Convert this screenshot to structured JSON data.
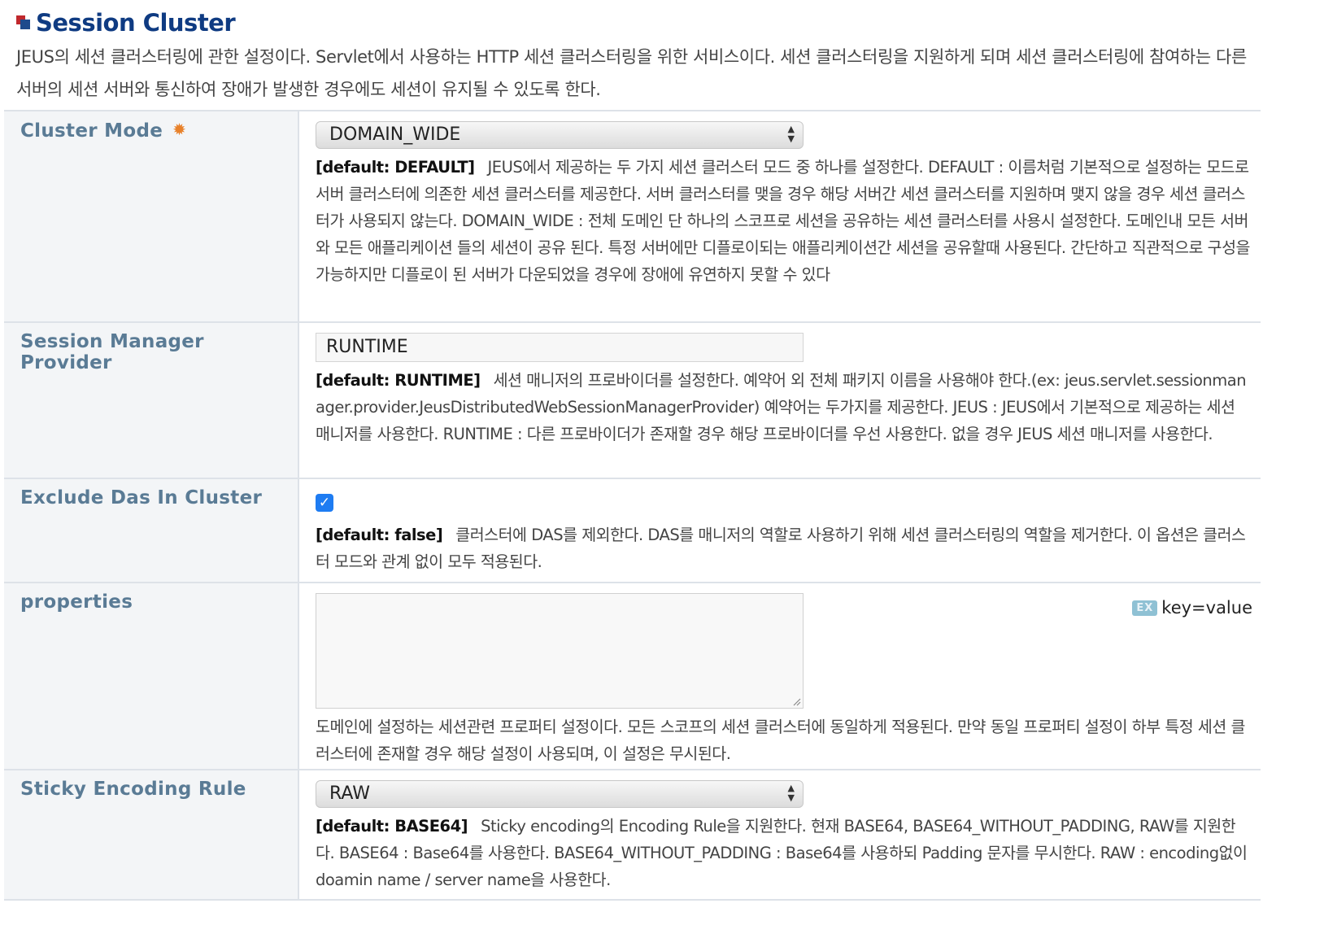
{
  "header": {
    "title": "Session Cluster",
    "description": "JEUS의 세션 클러스터링에 관한 설정이다. Servlet에서 사용하는 HTTP 세션 클러스터링을 위한 서비스이다. 세션 클러스터링을 지원하게 되며 세션 클러스터링에 참여하는 다른 서버의 세션 서버와 통신하여 장애가 발생한 경우에도 세션이 유지될 수 있도록 한다."
  },
  "fields": {
    "cluster_mode": {
      "label": "Cluster Mode",
      "required_icon": "gear-icon",
      "value": "DOMAIN_WIDE",
      "default": "[default: DEFAULT]",
      "description": "JEUS에서 제공하는 두 가지 세션 클러스터 모드 중 하나를 설정한다. DEFAULT : 이름처럼 기본적으로 설정하는 모드로 서버 클러스터에 의존한 세션 클러스터를 제공한다. 서버 클러스터를 맺을 경우 해당 서버간 세션 클러스터를 지원하며 맺지 않을 경우 세션 클러스터가 사용되지 않는다. DOMAIN_WIDE : 전체 도메인 단 하나의 스코프로 세션을 공유하는 세션 클러스터를 사용시 설정한다. 도메인내 모든 서버와 모든 애플리케이션 들의 세션이 공유 된다. 특정 서버에만 디플로이되는 애플리케이션간 세션을 공유할때 사용된다. 간단하고 직관적으로 구성을 가능하지만 디플로이 된 서버가 다운되었을 경우에 장애에 유연하지 못할 수 있다"
    },
    "session_manager_provider": {
      "label": "Session Manager Provider",
      "value": "RUNTIME",
      "default": "[default: RUNTIME]",
      "description": "세션 매니저의 프로바이더를 설정한다. 예약어 외 전체 패키지 이름을 사용해야 한다.(ex: jeus.servlet.sessionmanager.provider.JeusDistributedWebSessionManagerProvider) 예약어는 두가지를 제공한다. JEUS : JEUS에서 기본적으로 제공하는 세션 매니저를 사용한다. RUNTIME : 다른 프로바이더가 존재할 경우 해당 프로바이더를 우선 사용한다. 없을 경우 JEUS 세션 매니저를 사용한다."
    },
    "exclude_das": {
      "label": "Exclude Das In Cluster",
      "checked": true,
      "check_glyph": "✓",
      "default": "[default: false]",
      "description": "클러스터에 DAS를 제외한다. DAS를 매니저의 역할로 사용하기 위해 세션 클러스터링의 역할을 제거한다. 이 옵션은 클러스터 모드와 관계 없이 모두 적용된다."
    },
    "properties": {
      "label": "properties",
      "value": "",
      "example_badge": "EX",
      "example": "key=value",
      "description": "도메인에 설정하는 세션관련 프로퍼티 설정이다. 모든 스코프의 세션 클러스터에 동일하게 적용된다. 만약 동일 프로퍼티 설정이 하부 특정 세션 클러스터에 존재할 경우 해당 설정이 사용되며, 이 설정은 무시된다."
    },
    "sticky_encoding_rule": {
      "label": "Sticky Encoding Rule",
      "value": "RAW",
      "default": "[default: BASE64]",
      "description": "Sticky encoding의 Encoding Rule을 지원한다. 현재 BASE64, BASE64_WITHOUT_PADDING, RAW를 지원한다. BASE64 : Base64를 사용한다. BASE64_WITHOUT_PADDING : Base64를 사용하되 Padding 문자를 무시한다. RAW : encoding없이 doamin name / server name을 사용한다."
    }
  },
  "colors": {
    "title": "#0f3b82",
    "label": "#5a7b95",
    "label_bg": "#f3f5f7",
    "border": "#dde2e8",
    "checkbox": "#1e7cf2",
    "required_icon": "#e8812a"
  }
}
